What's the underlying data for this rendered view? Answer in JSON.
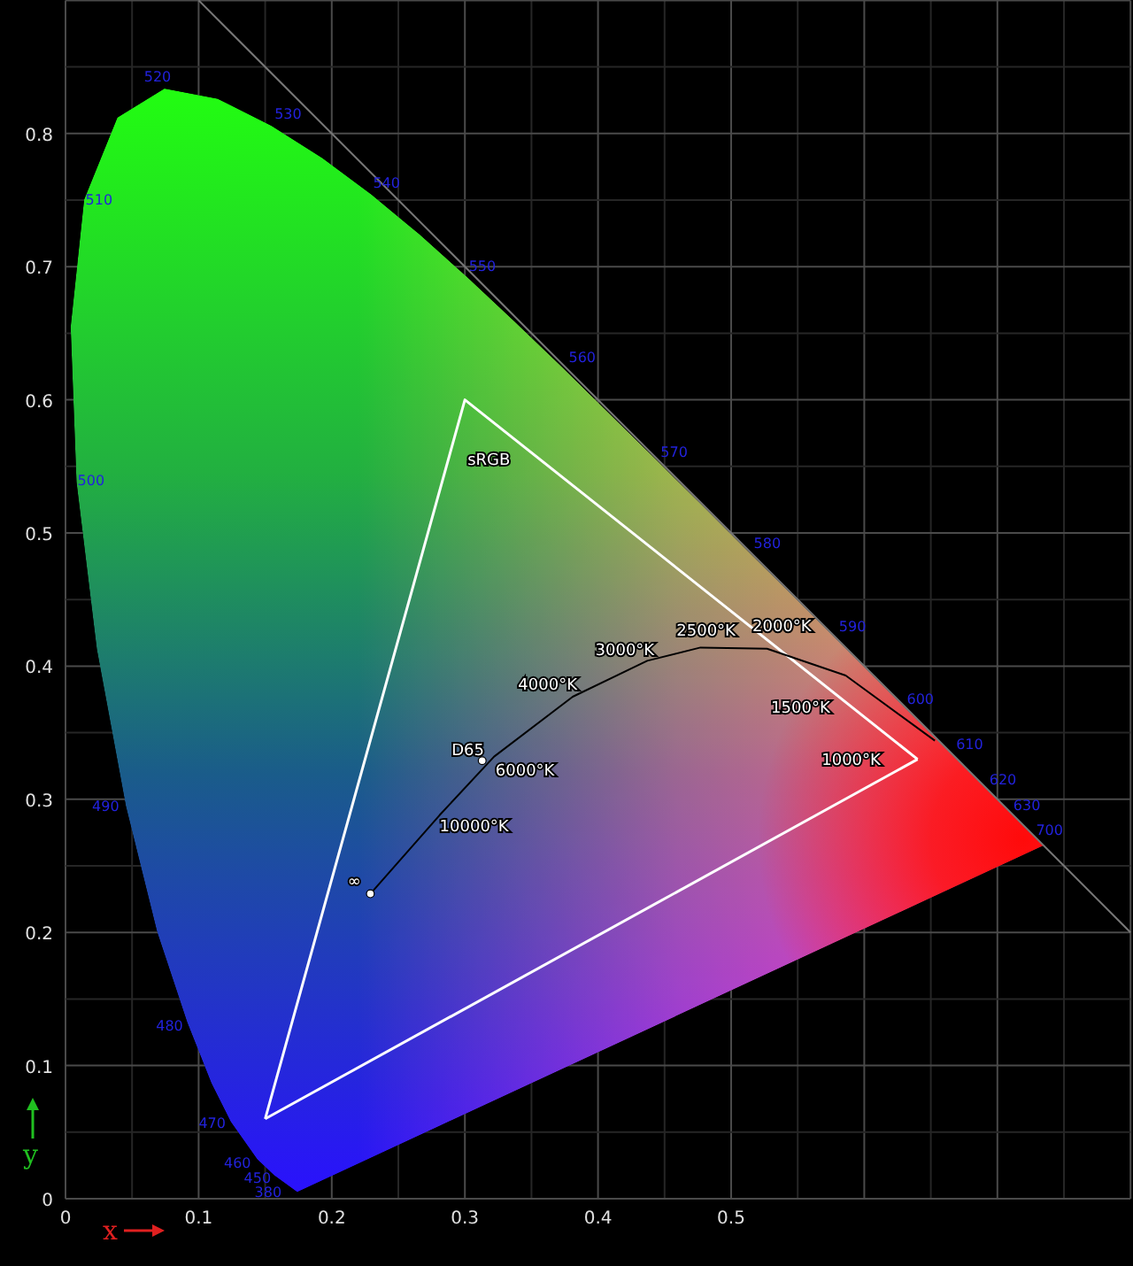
{
  "diagram": {
    "chart_data": {
      "type": "line",
      "xlabel": "x",
      "ylabel": "y",
      "xlim": [
        0,
        0.8
      ],
      "ylim": [
        0,
        0.9
      ],
      "xticks": [
        0,
        0.1,
        0.2,
        0.3,
        0.4,
        0.5
      ],
      "yticks": [
        0,
        0.1,
        0.2,
        0.3,
        0.4,
        0.5,
        0.6,
        0.7,
        0.8
      ],
      "grid": true,
      "x": [
        0.1,
        0.15,
        0.229,
        0.281,
        0.3,
        0.313,
        0.322,
        0.381,
        0.437,
        0.477,
        0.527,
        0.586,
        0.64,
        0.653,
        0.8
      ],
      "series": [
        {
          "name": "sRGB",
          "color": "#ffffff",
          "values": [
            null,
            0.06,
            null,
            null,
            0.6,
            null,
            null,
            null,
            null,
            null,
            null,
            null,
            0.33,
            null,
            null
          ]
        },
        {
          "color": "#ffffff",
          "values": [
            null,
            0.06,
            null,
            null,
            null,
            null,
            null,
            null,
            null,
            null,
            null,
            null,
            0.33,
            null,
            null
          ]
        },
        {
          "color": "#000000",
          "values": [
            null,
            null,
            0.229,
            0.288,
            null,
            null,
            0.332,
            0.377,
            0.404,
            0.414,
            0.413,
            0.393,
            null,
            0.344,
            null
          ]
        },
        {
          "name": "D65",
          "color": "#ffffff",
          "marker": true,
          "values": [
            null,
            null,
            null,
            null,
            null,
            0.329,
            null,
            null,
            null,
            null,
            null,
            null,
            null,
            null,
            null
          ]
        },
        {
          "color": "#777777",
          "values": [
            0.9,
            null,
            null,
            null,
            null,
            null,
            null,
            null,
            null,
            null,
            null,
            null,
            null,
            null,
            0.2
          ]
        }
      ],
      "annotations": [
        "∞",
        "10000°K",
        "6000°K",
        "4000°K",
        "3000°K",
        "2500°K",
        "2000°K",
        "1500°K",
        "1000°K"
      ]
    },
    "wavelength_labels": [
      "520",
      "530",
      "540",
      "550",
      "560",
      "570",
      "580",
      "590",
      "600",
      "610",
      "620",
      "630",
      "700",
      "510",
      "500",
      "490",
      "480",
      "470",
      "460",
      "450",
      "380"
    ]
  }
}
